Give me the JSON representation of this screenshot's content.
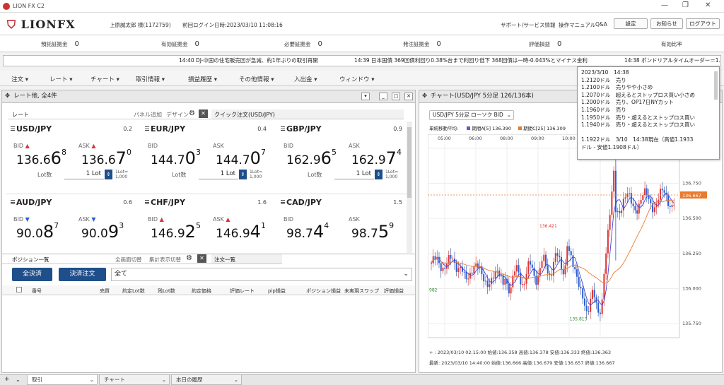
{
  "window": {
    "title": "LION FX C2",
    "min": "—",
    "max": "❐",
    "close": "✕"
  },
  "header": {
    "logo": "LIONFX",
    "user": "上原誠太郎 様(1172759)",
    "last_login": "前回ログイン日時:2023/03/10 11:08:16",
    "links": [
      "サポート/サービス情報",
      "操作マニュアル",
      "Q&A"
    ],
    "buttons": [
      "設定",
      "お知らせ",
      "ログアウト"
    ]
  },
  "balance": [
    {
      "label": "預託証拠金",
      "value": "0"
    },
    {
      "label": "有効証拠金",
      "value": "0"
    },
    {
      "label": "必要証拠金",
      "value": "0"
    },
    {
      "label": "発注証拠金",
      "value": "0"
    },
    {
      "label": "評価損益",
      "value": "0"
    },
    {
      "label": "有効比率",
      "value": ""
    }
  ],
  "ticker": {
    "items": [
      "14:40 DJ-中国の住宅販売回が急減、約1年ぶりの取引再開",
      "14:39 日本国債 369回債利回り0.38%台まで利回り低下 368回債は一時-0.043%とマイナス金利",
      "14:38 ポンドリアルタイムオーダー＝1.1940ドル"
    ]
  },
  "menu": [
    "注文",
    "レート",
    "チャート",
    "取引情報",
    "損益履歴",
    "その他情報",
    "入出金",
    "ウィンドウ"
  ],
  "rate_panel": {
    "title": "レート他, 全4件",
    "tab_label": "レート",
    "panel_add": "パネル追加",
    "design": "デザイン",
    "quick_order": "クイック注文(USD/JPY)",
    "cards": [
      {
        "symbol": "USD/JPY",
        "spread": "0.2",
        "bid_main": "136.6",
        "bid_big": "6",
        "bid_sup": "8",
        "ask_main": "136.6",
        "ask_big": "7",
        "ask_sup": "0",
        "bid_dir": "▲",
        "ask_dir": "▲",
        "lot": "1 Lot",
        "lot_unit1": "1Lot=",
        "lot_unit2": "1,000"
      },
      {
        "symbol": "EUR/JPY",
        "spread": "0.4",
        "bid_main": "144.7",
        "bid_big": "0",
        "bid_sup": "3",
        "ask_main": "144.7",
        "ask_big": "0",
        "ask_sup": "7",
        "bid_dir": "",
        "ask_dir": "",
        "lot": "1 Lot",
        "lot_unit1": "1Lot=",
        "lot_unit2": "1,000"
      },
      {
        "symbol": "GBP/JPY",
        "spread": "0.9",
        "bid_main": "162.9",
        "bid_big": "6",
        "bid_sup": "5",
        "ask_main": "162.9",
        "ask_big": "7",
        "ask_sup": "4",
        "bid_dir": "",
        "ask_dir": "",
        "lot": "1 Lot",
        "lot_unit1": "1Lot=",
        "lot_unit2": "1,000"
      },
      {
        "symbol": "AUD/JPY",
        "spread": "0.6",
        "bid_main": "90.0",
        "bid_big": "8",
        "bid_sup": "7",
        "ask_main": "90.0",
        "ask_big": "9",
        "ask_sup": "3",
        "bid_dir": "▼",
        "ask_dir": "▼",
        "lot": "",
        "lot_unit1": "",
        "lot_unit2": ""
      },
      {
        "symbol": "CHF/JPY",
        "spread": "1.6",
        "bid_main": "146.9",
        "bid_big": "2",
        "bid_sup": "5",
        "ask_main": "146.9",
        "ask_big": "4",
        "ask_sup": "1",
        "bid_dir": "▲",
        "ask_dir": "▲",
        "lot": "",
        "lot_unit1": "",
        "lot_unit2": ""
      },
      {
        "symbol": "CAD/JPY",
        "spread": "1.5",
        "bid_main": "98.7",
        "bid_big": "4",
        "bid_sup": "4",
        "ask_main": "98.7",
        "ask_big": "5",
        "ask_sup": "9",
        "bid_dir": "",
        "ask_dir": "",
        "lot": "",
        "lot_unit1": "",
        "lot_unit2": ""
      }
    ],
    "bid_label": "BID",
    "ask_label": "ASK",
    "lot_label": "Lot数"
  },
  "position": {
    "title": "ポジション一覧",
    "toggle1": "全画面切替",
    "toggle2": "集計表示切替",
    "order_list": "注文一覧",
    "settle_all": "全決済",
    "settle_order": "決済注文",
    "filter": "全て",
    "columns": [
      "番号",
      "売買",
      "約定Lot数",
      "残Lot数",
      "約定価格",
      "評価レート",
      "pip損益",
      "ポジション損益",
      "未実現スワップ",
      "評価損益"
    ]
  },
  "chart_panel": {
    "title": "チャート(USD/JPY 5分足 126/136本)",
    "selector": "USD/JPY 5分足 ローソク BID",
    "ma_label": "単純移動平均:",
    "ma1": "期間A[5] 136.390",
    "ma2": "期間C[25] 136.309",
    "footer1": "+ : 2023/03/10 02:15:00  始値:136.358  高値:136.378  安値:136.333  終値:136.363",
    "footer2": "最新: 2023/03/10 14:40:00  始値:136.666  高値:136.679  安値:136.657  終値:136.667"
  },
  "tooltip": {
    "lines": [
      "2023/3/10　14:38",
      "1.2120ドル　売り",
      "1.2100ドル　売りやや小さめ",
      "1.2070ドル　超えるとストップロス買い小さめ",
      "1.2000ドル　売り、OP17日NYカット",
      "1.1960ドル　売り",
      "1.1950ドル　売り・超えるとストップロス買い",
      "1.1940ドル　売り・超えるとストップロス買い",
      "",
      "1.1922ドル　3/10　14:38現在（高値1.1933",
      "ドル - 安値1.1908ドル）"
    ]
  },
  "chart_data": {
    "type": "candlestick",
    "y_ticks": [
      "137.000",
      "136.750",
      "136.500",
      "136.250",
      "136.000",
      "135.750"
    ],
    "x_ticks": [
      "05:00",
      "06:00",
      "08:00",
      "09:00",
      "10:00",
      "11:00"
    ],
    "current": "136.667",
    "annotations": {
      "high": "136.966",
      "mid": "136.421",
      "low": "135.813",
      "left": "982"
    },
    "ylim": [
      135.65,
      137.1
    ]
  },
  "bottom_tabs": [
    "取引",
    "チャート",
    "本日の履歴"
  ],
  "colors": {
    "accent": "#1f4f8a",
    "up": "#d33",
    "down": "#2a5bd7"
  }
}
